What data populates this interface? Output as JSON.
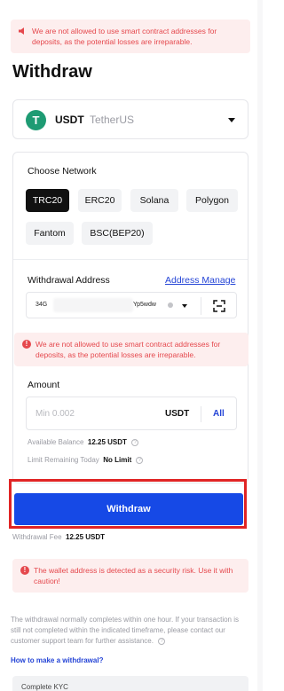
{
  "top_alert": {
    "text": "We are not allowed to use smart contract addresses for deposits, as the potential losses are irreparable."
  },
  "page_title": "Withdraw",
  "coin": {
    "symbol": "USDT",
    "name": "TetherUS",
    "logo_letter": "T",
    "logo_color": "#1e9b73"
  },
  "network": {
    "label": "Choose Network",
    "selected": "TRC20",
    "options": [
      "TRC20",
      "ERC20",
      "Solana",
      "Polygon",
      "Fantom",
      "BSC(BEP20)"
    ]
  },
  "address": {
    "label": "Withdrawal Address",
    "manage_label": "Address Manage",
    "value_start": "34G",
    "value_end": "Yp5wdw",
    "scan_icon": "scan-icon"
  },
  "card_alert": {
    "text": "We are not allowed to use smart contract addresses for deposits, as the potential losses are irreparable."
  },
  "amount": {
    "label": "Amount",
    "placeholder": "Min 0.002",
    "unit": "USDT",
    "all_label": "All"
  },
  "balance": {
    "available_label": "Available Balance",
    "available_value": "12.25 USDT",
    "limit_label": "Limit Remaining Today",
    "limit_value": "No Limit"
  },
  "withdraw_button": "Withdraw",
  "fee": {
    "label": "Withdrawal Fee",
    "value": "12.25 USDT"
  },
  "risk_alert": {
    "text": "The wallet address is detected as a security risk. Use it with caution!"
  },
  "note": "The withdrawal normally completes within one hour. If your transaction is still not completed within the indicated timeframe, please contact our customer support team for further assistance.",
  "how_to_link": "How to make a withdrawal?",
  "kyc_label": "Complete KYC",
  "colors": {
    "accent": "#1649e6",
    "link": "#2444d6",
    "danger": "#e5484d",
    "highlight_outline": "#e02424"
  }
}
